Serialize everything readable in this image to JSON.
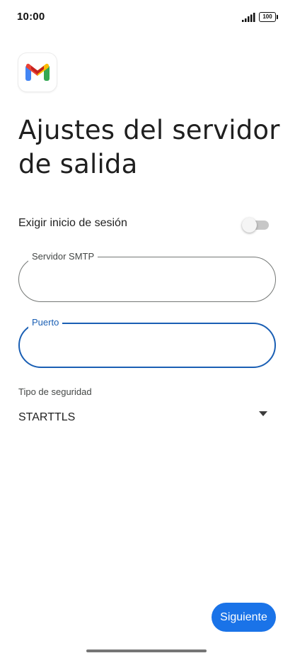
{
  "status_bar": {
    "time": "10:00",
    "battery": "100",
    "icons": [
      "signal-icon",
      "battery-icon"
    ]
  },
  "app": {
    "logo": "gmail-logo-icon"
  },
  "page": {
    "title": "Ajustes del servidor de salida"
  },
  "login_toggle": {
    "label": "Exigir inicio de sesión",
    "state": "off"
  },
  "smtp_field": {
    "label": "Servidor SMTP",
    "value": ""
  },
  "port_field": {
    "label": "Puerto",
    "value": "",
    "focused": true
  },
  "security": {
    "label": "Tipo de seguridad",
    "selected": "STARTTLS",
    "icon": "dropdown-arrow-icon"
  },
  "next_button": {
    "label": "Siguiente"
  },
  "colors": {
    "accent": "#1a73e8",
    "focus": "#1a5fb4",
    "text": "#1f1f1f",
    "secondary_text": "#444746",
    "outline": "#747775",
    "toggle_off": "#c7c7c7"
  }
}
